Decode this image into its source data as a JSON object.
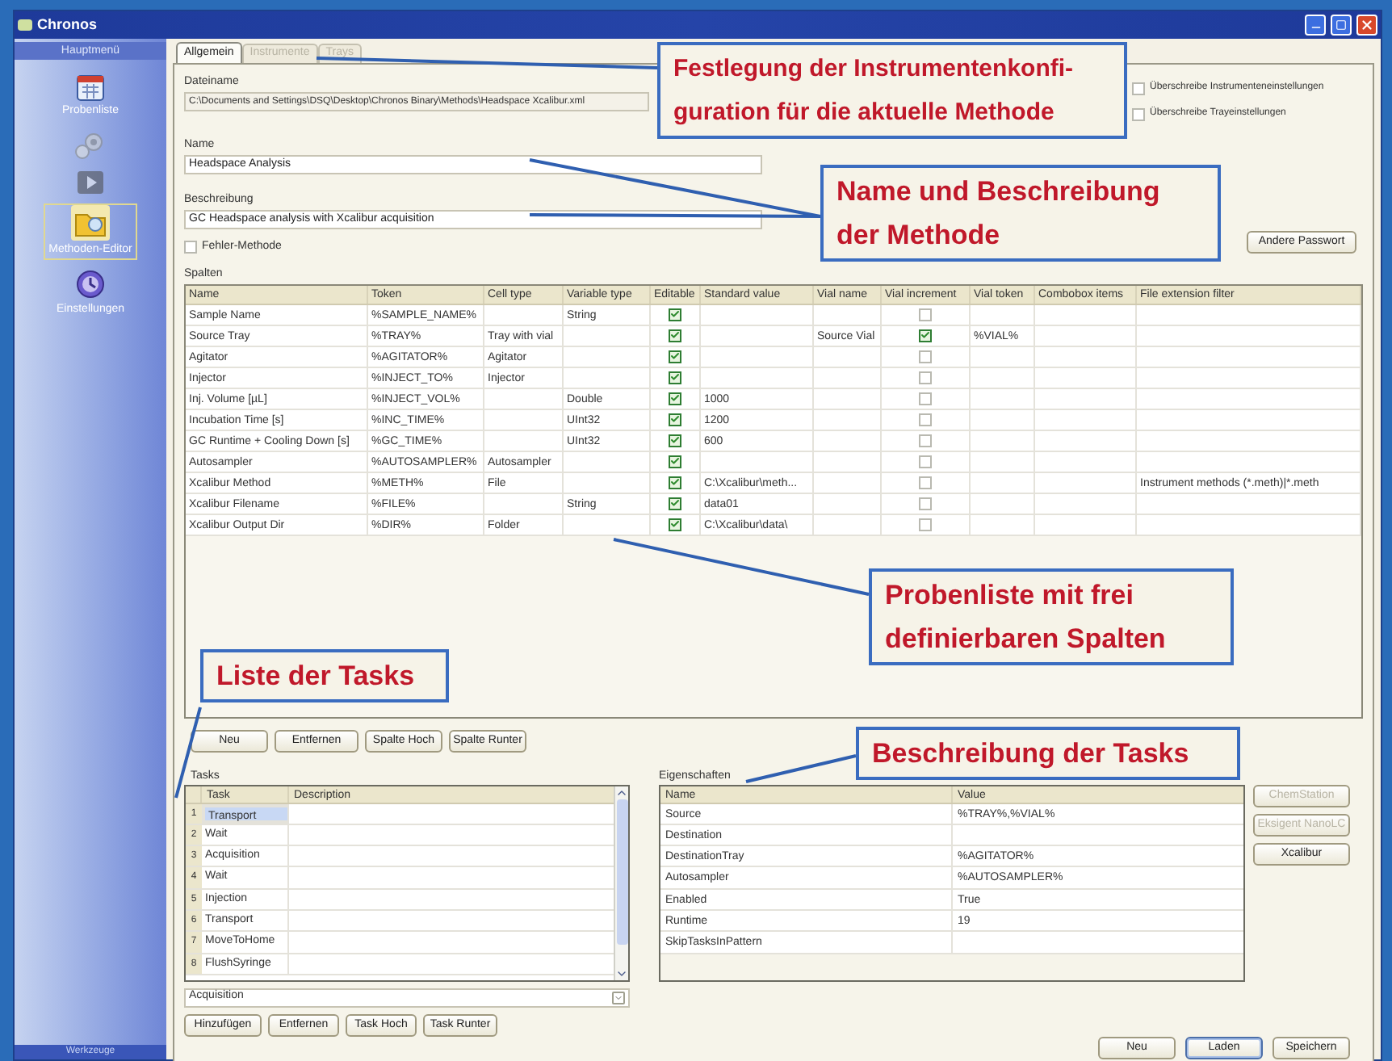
{
  "window": {
    "title": "Chronos"
  },
  "sidebar": {
    "header": "Hauptmenü",
    "footer": "Werkzeuge",
    "items": [
      {
        "label": "Probenliste",
        "disabled": false,
        "selected": false
      },
      {
        "disabled": true,
        "selected": false
      },
      {
        "disabled": true,
        "selected": false
      },
      {
        "label": "Methoden-Editor",
        "disabled": false,
        "selected": true
      },
      {
        "label": "Einstellungen",
        "disabled": false,
        "selected": false
      }
    ]
  },
  "tabs": [
    {
      "label": "Allgemein",
      "selected": true,
      "disabled": false
    },
    {
      "label": "Instrumente",
      "selected": false,
      "disabled": true
    },
    {
      "label": "Trays",
      "selected": false,
      "disabled": true
    }
  ],
  "fields": {
    "dateiname": {
      "label": "Dateiname",
      "value": "C:\\Documents and Settings\\DSQ\\Desktop\\Chronos Binary\\Methods\\Headspace Xcalibur.xml"
    },
    "name": {
      "label": "Name",
      "value": "Headspace Analysis"
    },
    "beschreibung": {
      "label": "Beschreibung",
      "value": "GC Headspace analysis with Xcalibur acquisition"
    }
  },
  "fehler_methode": {
    "label": "Fehler-Methode",
    "checked": false
  },
  "options": [
    {
      "label": "Überschreibe Instrumenteneinstellungen",
      "checked": false
    },
    {
      "label": "Überschreibe Trayeinstellungen",
      "checked": false
    }
  ],
  "password_button": "Andere Passwort",
  "spalten": {
    "label": "Spalten",
    "columns": [
      "Name",
      "Token",
      "Cell type",
      "Variable type",
      "Editable",
      "Standard value",
      "Vial name",
      "Vial increment",
      "Vial token",
      "Combobox items",
      "File extension filter"
    ],
    "rows": [
      {
        "name": "Sample Name",
        "token": "%SAMPLE_NAME%",
        "cell_type": "",
        "variable_type": "String",
        "editable": true,
        "standard_value": "",
        "vial_name": "",
        "vial_increment": false,
        "vial_token": "",
        "file_filter": ""
      },
      {
        "name": "Source Tray",
        "token": "%TRAY%",
        "cell_type": "Tray with vial",
        "variable_type": "",
        "editable": true,
        "standard_value": "",
        "vial_name": "Source Vial",
        "vial_increment": true,
        "vial_token": "%VIAL%",
        "file_filter": ""
      },
      {
        "name": "Agitator",
        "token": "%AGITATOR%",
        "cell_type": "Agitator",
        "variable_type": "",
        "editable": true,
        "standard_value": "",
        "vial_name": "",
        "vial_increment": false,
        "vial_token": "",
        "file_filter": ""
      },
      {
        "name": "Injector",
        "token": "%INJECT_TO%",
        "cell_type": "Injector",
        "variable_type": "",
        "editable": true,
        "standard_value": "",
        "vial_name": "",
        "vial_increment": false,
        "vial_token": "",
        "file_filter": ""
      },
      {
        "name": "Inj. Volume [µL]",
        "token": "%INJECT_VOL%",
        "cell_type": "",
        "variable_type": "Double",
        "editable": true,
        "standard_value": "1000",
        "vial_name": "",
        "vial_increment": false,
        "vial_token": "",
        "file_filter": ""
      },
      {
        "name": "Incubation Time [s]",
        "token": "%INC_TIME%",
        "cell_type": "",
        "variable_type": "UInt32",
        "editable": true,
        "standard_value": "1200",
        "vial_name": "",
        "vial_increment": false,
        "vial_token": "",
        "file_filter": ""
      },
      {
        "name": "GC Runtime + Cooling Down [s]",
        "token": "%GC_TIME%",
        "cell_type": "",
        "variable_type": "UInt32",
        "editable": true,
        "standard_value": "600",
        "vial_name": "",
        "vial_increment": false,
        "vial_token": "",
        "file_filter": ""
      },
      {
        "name": "Autosampler",
        "token": "%AUTOSAMPLER%",
        "cell_type": "Autosampler",
        "variable_type": "",
        "editable": true,
        "standard_value": "",
        "vial_name": "",
        "vial_increment": false,
        "vial_token": "",
        "file_filter": ""
      },
      {
        "name": "Xcalibur Method",
        "token": "%METH%",
        "cell_type": "File",
        "variable_type": "",
        "editable": true,
        "standard_value": "C:\\Xcalibur\\meth...",
        "vial_name": "",
        "vial_increment": false,
        "vial_token": "",
        "file_filter": "Instrument methods (*.meth)|*.meth"
      },
      {
        "name": "Xcalibur Filename",
        "token": "%FILE%",
        "cell_type": "",
        "variable_type": "String",
        "editable": true,
        "standard_value": "data01",
        "vial_name": "",
        "vial_increment": false,
        "vial_token": "",
        "file_filter": ""
      },
      {
        "name": "Xcalibur Output Dir",
        "token": "%DIR%",
        "cell_type": "Folder",
        "variable_type": "",
        "editable": true,
        "standard_value": "C:\\Xcalibur\\data\\",
        "vial_name": "",
        "vial_increment": false,
        "vial_token": "",
        "file_filter": ""
      }
    ]
  },
  "spalten_buttons": [
    "Neu",
    "Entfernen",
    "Spalte Hoch",
    "Spalte Runter"
  ],
  "tasks": {
    "label": "Tasks",
    "columns": [
      "Task",
      "Description"
    ],
    "rows": [
      {
        "number": "1",
        "task": "Transport",
        "selected": true
      },
      {
        "number": "2",
        "task": "Wait",
        "selected": false
      },
      {
        "number": "3",
        "task": "Acquisition",
        "selected": false
      },
      {
        "number": "4",
        "task": "Wait",
        "selected": false
      },
      {
        "number": "5",
        "task": "Injection",
        "selected": false
      },
      {
        "number": "6",
        "task": "Transport",
        "selected": false
      },
      {
        "number": "7",
        "task": "MoveToHome",
        "selected": false
      },
      {
        "number": "8",
        "task": "FlushSyringe",
        "selected": false
      }
    ],
    "combo": "Acquisition"
  },
  "task_buttons": [
    "Hinzufügen",
    "Entfernen",
    "Task Hoch",
    "Task Runter"
  ],
  "eigenschaften": {
    "label": "Eigenschaften",
    "columns": [
      "Name",
      "Value"
    ],
    "rows": [
      {
        "name": "Source",
        "value": "%TRAY%,%VIAL%"
      },
      {
        "name": "Destination",
        "value": ""
      },
      {
        "name": "DestinationTray",
        "value": "%AGITATOR%"
      },
      {
        "name": "Autosampler",
        "value": "%AUTOSAMPLER%"
      },
      {
        "name": "Enabled",
        "value": "True"
      },
      {
        "name": "Runtime",
        "value": "19"
      },
      {
        "name": "SkipTasksInPattern",
        "value": ""
      }
    ]
  },
  "instrument_buttons": [
    {
      "label": "ChemStation",
      "disabled": true
    },
    {
      "label": "Eksigent NanoLC",
      "disabled": true
    },
    {
      "label": "Xcalibur",
      "disabled": false
    }
  ],
  "footer_buttons": [
    {
      "label": "Neu",
      "default": false
    },
    {
      "label": "Laden",
      "default": true
    },
    {
      "label": "Speichern",
      "default": false
    }
  ],
  "callouts": [
    {
      "lines": [
        "Festlegung der Instrumentenkonfi-",
        "guration für die aktuelle Methode"
      ]
    },
    {
      "lines": [
        "Name und Beschreibung",
        "der Methode"
      ]
    },
    {
      "lines": [
        "Probenliste mit frei",
        "definierbaren Spalten"
      ]
    },
    {
      "lines": [
        "Liste der Tasks"
      ]
    },
    {
      "lines": [
        "Beschreibung der Tasks"
      ]
    }
  ]
}
